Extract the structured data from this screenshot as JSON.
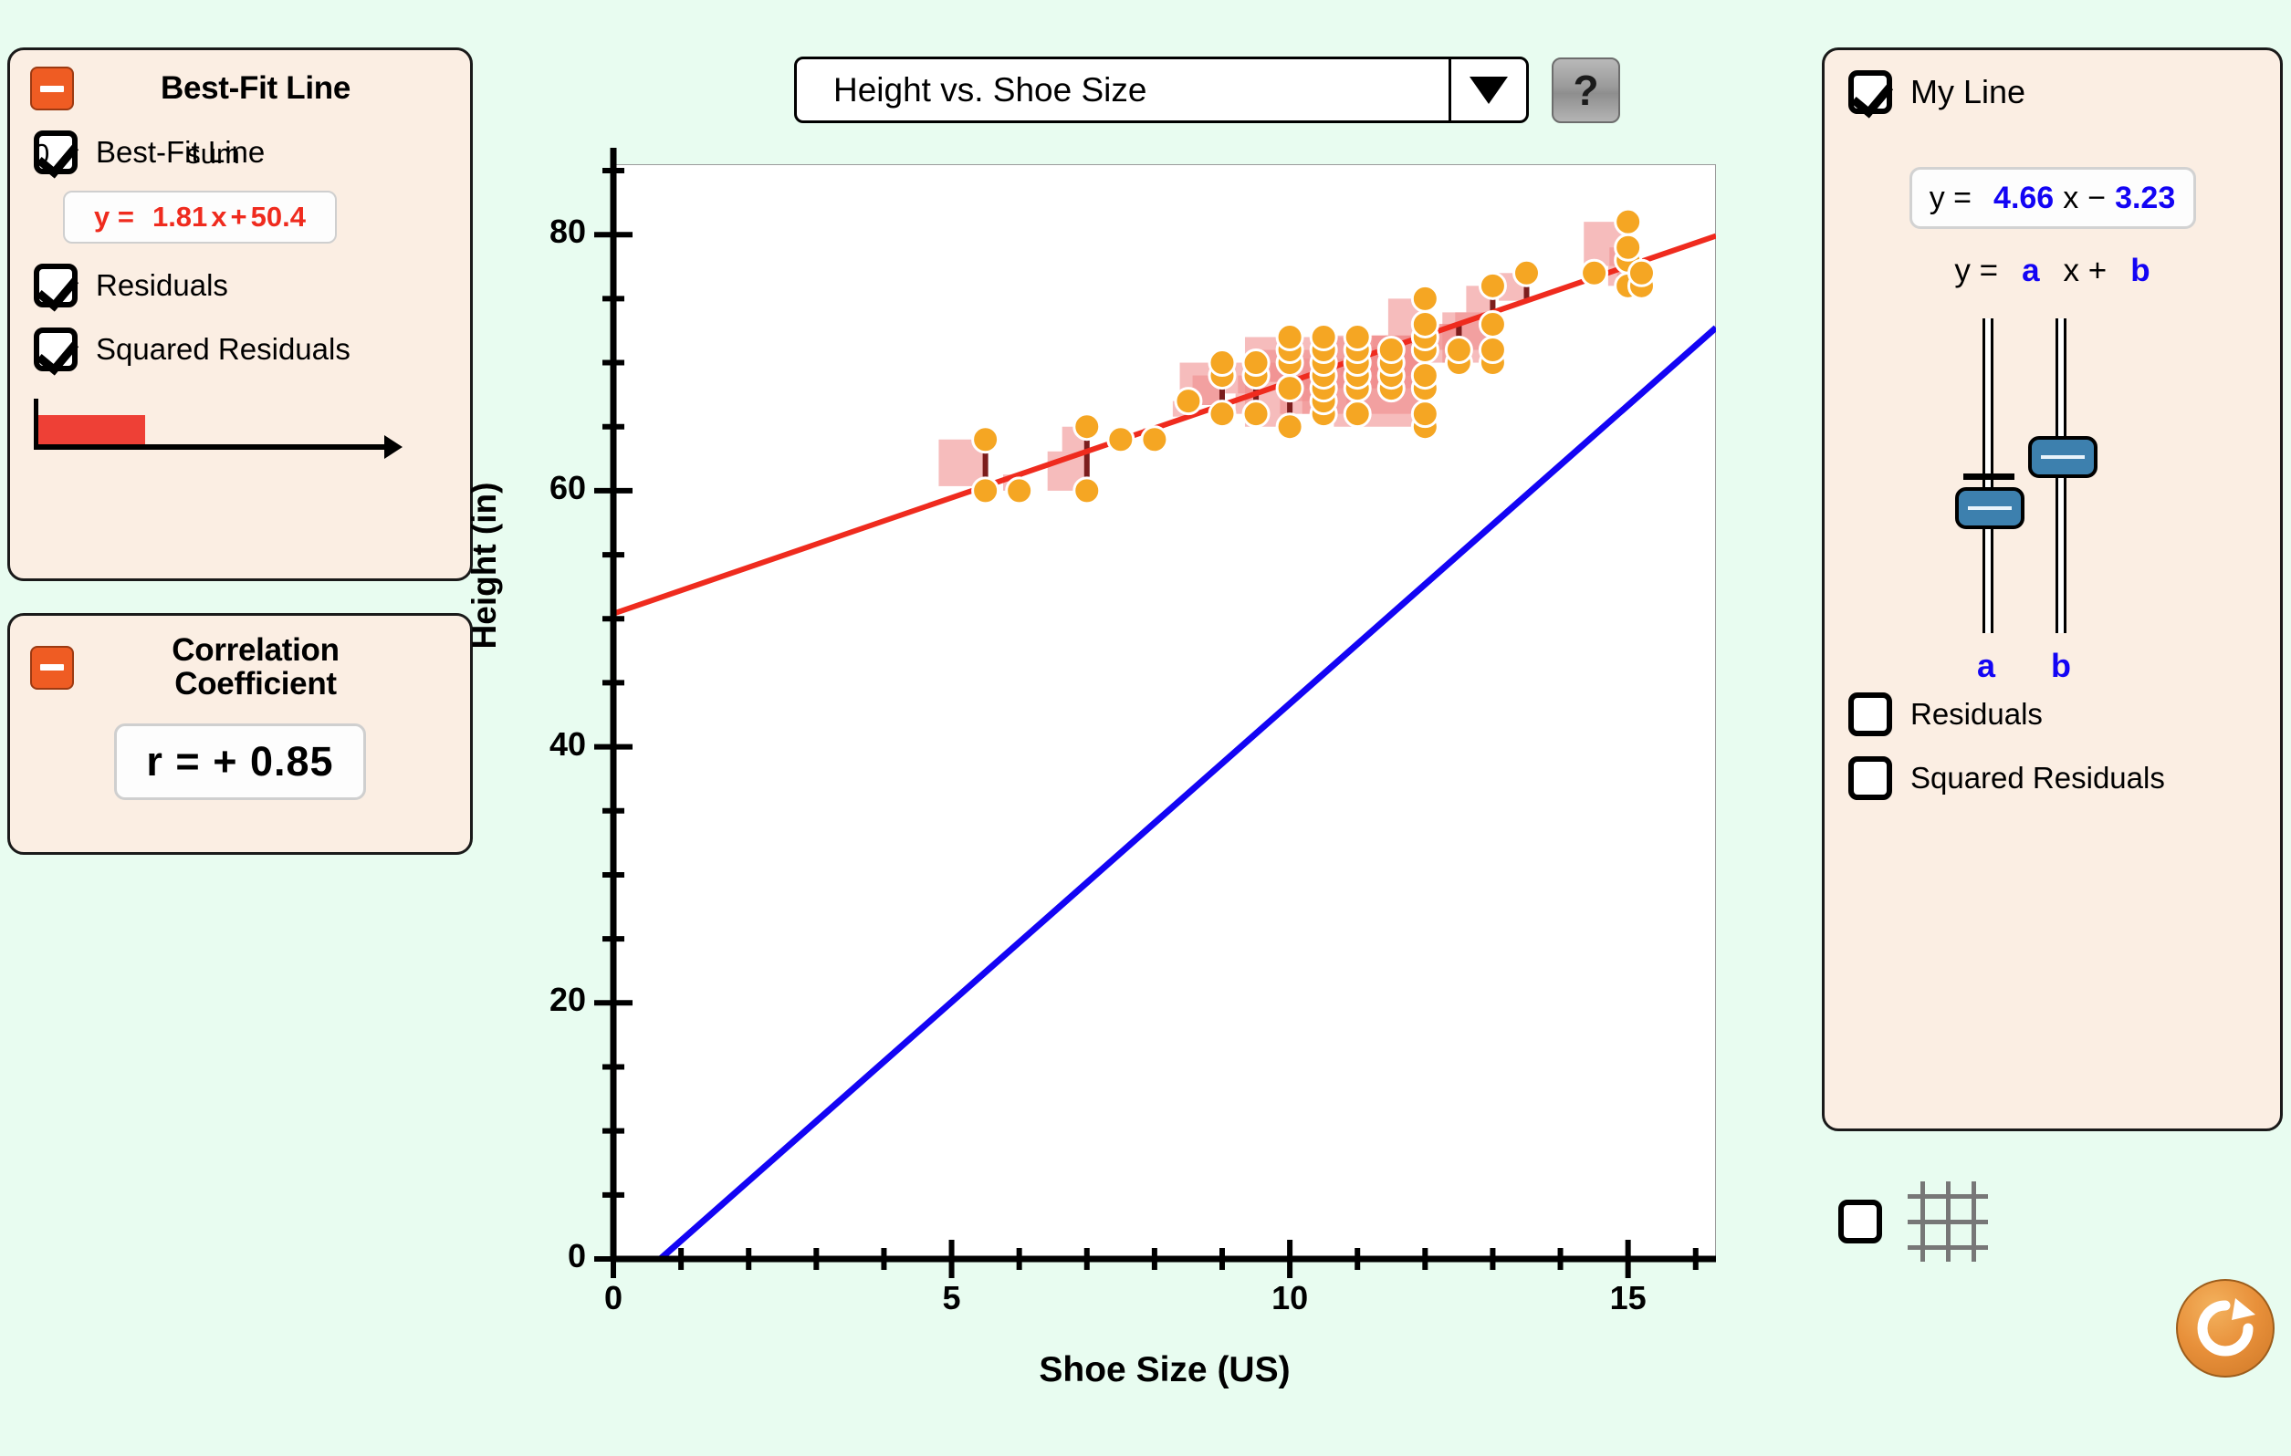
{
  "background_color": "#e8fcf0",
  "best_fit_panel": {
    "title": "Best-Fit Line",
    "collapse_icon": "minus-icon",
    "checkboxes": [
      {
        "label": "Best-Fit Line",
        "checked": true
      },
      {
        "label": "Residuals",
        "checked": true
      },
      {
        "label": "Squared Residuals",
        "checked": true
      }
    ],
    "equation": {
      "prefix": "y =",
      "slope": "1.81",
      "x": "x",
      "sign": "+",
      "intercept": "50.4",
      "color": "#ef2b1e"
    },
    "sum_bar": {
      "zero_label": "0",
      "sum_label": "sum",
      "fill_fraction": 0.3,
      "fill_color": "#ee4036"
    }
  },
  "correlation_panel": {
    "title_line1": "Correlation",
    "title_line2": "Coefficient",
    "collapse_icon": "minus-icon",
    "r_value": "r = + 0.85"
  },
  "dataset_selector": {
    "selected": "Height vs. Shoe Size",
    "arrow_icon": "chevron-down-icon"
  },
  "help_button": {
    "label": "?",
    "icon": "question-mark-icon"
  },
  "my_line_panel": {
    "title": "My Line",
    "checked": true,
    "equation": {
      "prefix": "y =",
      "slope": "4.66",
      "x": "x",
      "sign": "−",
      "intercept": "3.23",
      "color": "#1304f4"
    },
    "equation_form": {
      "prefix": "y =",
      "a": "a",
      "mid": "x +",
      "b": "b"
    },
    "sliders": [
      {
        "name": "a",
        "value_fraction": 0.38
      },
      {
        "name": "b",
        "value_fraction": 0.57
      }
    ],
    "checkboxes": [
      {
        "label": "Residuals",
        "checked": false
      },
      {
        "label": "Squared Residuals",
        "checked": false
      }
    ]
  },
  "grid_control": {
    "checked": false,
    "icon": "grid-icon"
  },
  "reset_button": {
    "icon": "reset-arrow-icon",
    "color": "#e8903a"
  },
  "chart_data": {
    "type": "scatter",
    "title": "Height vs. Shoe Size",
    "xlabel": "Shoe Size (US)",
    "ylabel": "Height (in)",
    "xlim": [
      0,
      16.3
    ],
    "ylim": [
      0,
      85.5
    ],
    "x_ticks_major": [
      0,
      5,
      10,
      15
    ],
    "y_ticks_major": [
      0,
      20,
      40,
      60,
      80
    ],
    "x_tick_step_minor": 1,
    "y_tick_step_minor": 5,
    "grid": false,
    "legend": "none",
    "lines": [
      {
        "name": "Best-Fit Line",
        "color": "#ef2b1e",
        "slope": 1.81,
        "intercept": 50.4,
        "width": 6
      },
      {
        "name": "My Line",
        "color": "#1304f4",
        "slope": 4.66,
        "intercept": -3.23,
        "width": 7
      }
    ],
    "point_style": {
      "fill": "#f5a623",
      "stroke": "#ffffff",
      "radius": 14
    },
    "residual_line_color": "#7c1d1d",
    "squared_residual_color": "#f08b8b",
    "points": [
      [
        5.5,
        60.0
      ],
      [
        5.5,
        64.0
      ],
      [
        6.0,
        60.0
      ],
      [
        7.0,
        60.0
      ],
      [
        7.0,
        65.0
      ],
      [
        7.5,
        64.0
      ],
      [
        8.0,
        64.0
      ],
      [
        8.5,
        67.0
      ],
      [
        9.0,
        66.0
      ],
      [
        9.0,
        69.0
      ],
      [
        9.0,
        70.0
      ],
      [
        9.5,
        66.0
      ],
      [
        9.5,
        69.0
      ],
      [
        9.5,
        70.0
      ],
      [
        10.0,
        65.0
      ],
      [
        10.0,
        68.0
      ],
      [
        10.0,
        70.0
      ],
      [
        10.0,
        71.0
      ],
      [
        10.0,
        72.0
      ],
      [
        10.5,
        66.0
      ],
      [
        10.5,
        67.0
      ],
      [
        10.5,
        68.0
      ],
      [
        10.5,
        69.0
      ],
      [
        10.5,
        70.0
      ],
      [
        10.5,
        71.0
      ],
      [
        10.5,
        72.0
      ],
      [
        11.0,
        66.0
      ],
      [
        11.0,
        68.0
      ],
      [
        11.0,
        69.0
      ],
      [
        11.0,
        70.0
      ],
      [
        11.0,
        71.0
      ],
      [
        11.0,
        72.0
      ],
      [
        11.5,
        68.0
      ],
      [
        11.5,
        69.0
      ],
      [
        11.5,
        70.0
      ],
      [
        11.5,
        71.0
      ],
      [
        12.0,
        65.0
      ],
      [
        12.0,
        66.0
      ],
      [
        12.0,
        68.0
      ],
      [
        12.0,
        69.0
      ],
      [
        12.0,
        71.0
      ],
      [
        12.0,
        72.0
      ],
      [
        12.0,
        73.0
      ],
      [
        12.0,
        75.0
      ],
      [
        12.5,
        70.0
      ],
      [
        12.5,
        71.0
      ],
      [
        13.0,
        70.0
      ],
      [
        13.0,
        71.0
      ],
      [
        13.0,
        73.0
      ],
      [
        13.0,
        76.0
      ],
      [
        13.5,
        77.0
      ],
      [
        14.5,
        77.0
      ],
      [
        15.0,
        76.0
      ],
      [
        15.0,
        78.0
      ],
      [
        15.0,
        79.0
      ],
      [
        15.0,
        81.0
      ],
      [
        15.2,
        76.0
      ],
      [
        15.2,
        77.0
      ]
    ]
  }
}
